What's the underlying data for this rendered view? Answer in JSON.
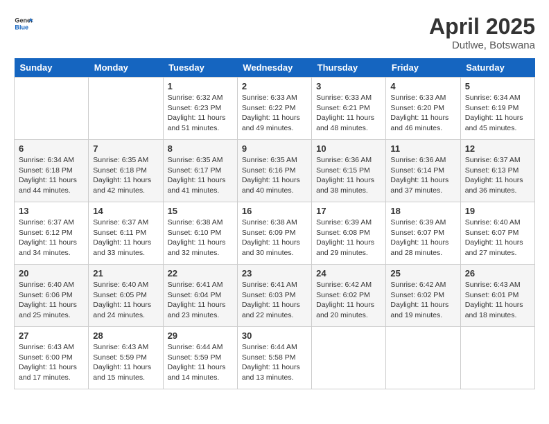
{
  "header": {
    "logo_general": "General",
    "logo_blue": "Blue",
    "month_title": "April 2025",
    "location": "Dutlwe, Botswana"
  },
  "calendar": {
    "days_of_week": [
      "Sunday",
      "Monday",
      "Tuesday",
      "Wednesday",
      "Thursday",
      "Friday",
      "Saturday"
    ],
    "weeks": [
      [
        {
          "day": "",
          "info": ""
        },
        {
          "day": "",
          "info": ""
        },
        {
          "day": "1",
          "info": "Sunrise: 6:32 AM\nSunset: 6:23 PM\nDaylight: 11 hours and 51 minutes."
        },
        {
          "day": "2",
          "info": "Sunrise: 6:33 AM\nSunset: 6:22 PM\nDaylight: 11 hours and 49 minutes."
        },
        {
          "day": "3",
          "info": "Sunrise: 6:33 AM\nSunset: 6:21 PM\nDaylight: 11 hours and 48 minutes."
        },
        {
          "day": "4",
          "info": "Sunrise: 6:33 AM\nSunset: 6:20 PM\nDaylight: 11 hours and 46 minutes."
        },
        {
          "day": "5",
          "info": "Sunrise: 6:34 AM\nSunset: 6:19 PM\nDaylight: 11 hours and 45 minutes."
        }
      ],
      [
        {
          "day": "6",
          "info": "Sunrise: 6:34 AM\nSunset: 6:18 PM\nDaylight: 11 hours and 44 minutes."
        },
        {
          "day": "7",
          "info": "Sunrise: 6:35 AM\nSunset: 6:18 PM\nDaylight: 11 hours and 42 minutes."
        },
        {
          "day": "8",
          "info": "Sunrise: 6:35 AM\nSunset: 6:17 PM\nDaylight: 11 hours and 41 minutes."
        },
        {
          "day": "9",
          "info": "Sunrise: 6:35 AM\nSunset: 6:16 PM\nDaylight: 11 hours and 40 minutes."
        },
        {
          "day": "10",
          "info": "Sunrise: 6:36 AM\nSunset: 6:15 PM\nDaylight: 11 hours and 38 minutes."
        },
        {
          "day": "11",
          "info": "Sunrise: 6:36 AM\nSunset: 6:14 PM\nDaylight: 11 hours and 37 minutes."
        },
        {
          "day": "12",
          "info": "Sunrise: 6:37 AM\nSunset: 6:13 PM\nDaylight: 11 hours and 36 minutes."
        }
      ],
      [
        {
          "day": "13",
          "info": "Sunrise: 6:37 AM\nSunset: 6:12 PM\nDaylight: 11 hours and 34 minutes."
        },
        {
          "day": "14",
          "info": "Sunrise: 6:37 AM\nSunset: 6:11 PM\nDaylight: 11 hours and 33 minutes."
        },
        {
          "day": "15",
          "info": "Sunrise: 6:38 AM\nSunset: 6:10 PM\nDaylight: 11 hours and 32 minutes."
        },
        {
          "day": "16",
          "info": "Sunrise: 6:38 AM\nSunset: 6:09 PM\nDaylight: 11 hours and 30 minutes."
        },
        {
          "day": "17",
          "info": "Sunrise: 6:39 AM\nSunset: 6:08 PM\nDaylight: 11 hours and 29 minutes."
        },
        {
          "day": "18",
          "info": "Sunrise: 6:39 AM\nSunset: 6:07 PM\nDaylight: 11 hours and 28 minutes."
        },
        {
          "day": "19",
          "info": "Sunrise: 6:40 AM\nSunset: 6:07 PM\nDaylight: 11 hours and 27 minutes."
        }
      ],
      [
        {
          "day": "20",
          "info": "Sunrise: 6:40 AM\nSunset: 6:06 PM\nDaylight: 11 hours and 25 minutes."
        },
        {
          "day": "21",
          "info": "Sunrise: 6:40 AM\nSunset: 6:05 PM\nDaylight: 11 hours and 24 minutes."
        },
        {
          "day": "22",
          "info": "Sunrise: 6:41 AM\nSunset: 6:04 PM\nDaylight: 11 hours and 23 minutes."
        },
        {
          "day": "23",
          "info": "Sunrise: 6:41 AM\nSunset: 6:03 PM\nDaylight: 11 hours and 22 minutes."
        },
        {
          "day": "24",
          "info": "Sunrise: 6:42 AM\nSunset: 6:02 PM\nDaylight: 11 hours and 20 minutes."
        },
        {
          "day": "25",
          "info": "Sunrise: 6:42 AM\nSunset: 6:02 PM\nDaylight: 11 hours and 19 minutes."
        },
        {
          "day": "26",
          "info": "Sunrise: 6:43 AM\nSunset: 6:01 PM\nDaylight: 11 hours and 18 minutes."
        }
      ],
      [
        {
          "day": "27",
          "info": "Sunrise: 6:43 AM\nSunset: 6:00 PM\nDaylight: 11 hours and 17 minutes."
        },
        {
          "day": "28",
          "info": "Sunrise: 6:43 AM\nSunset: 5:59 PM\nDaylight: 11 hours and 15 minutes."
        },
        {
          "day": "29",
          "info": "Sunrise: 6:44 AM\nSunset: 5:59 PM\nDaylight: 11 hours and 14 minutes."
        },
        {
          "day": "30",
          "info": "Sunrise: 6:44 AM\nSunset: 5:58 PM\nDaylight: 11 hours and 13 minutes."
        },
        {
          "day": "",
          "info": ""
        },
        {
          "day": "",
          "info": ""
        },
        {
          "day": "",
          "info": ""
        }
      ]
    ]
  }
}
